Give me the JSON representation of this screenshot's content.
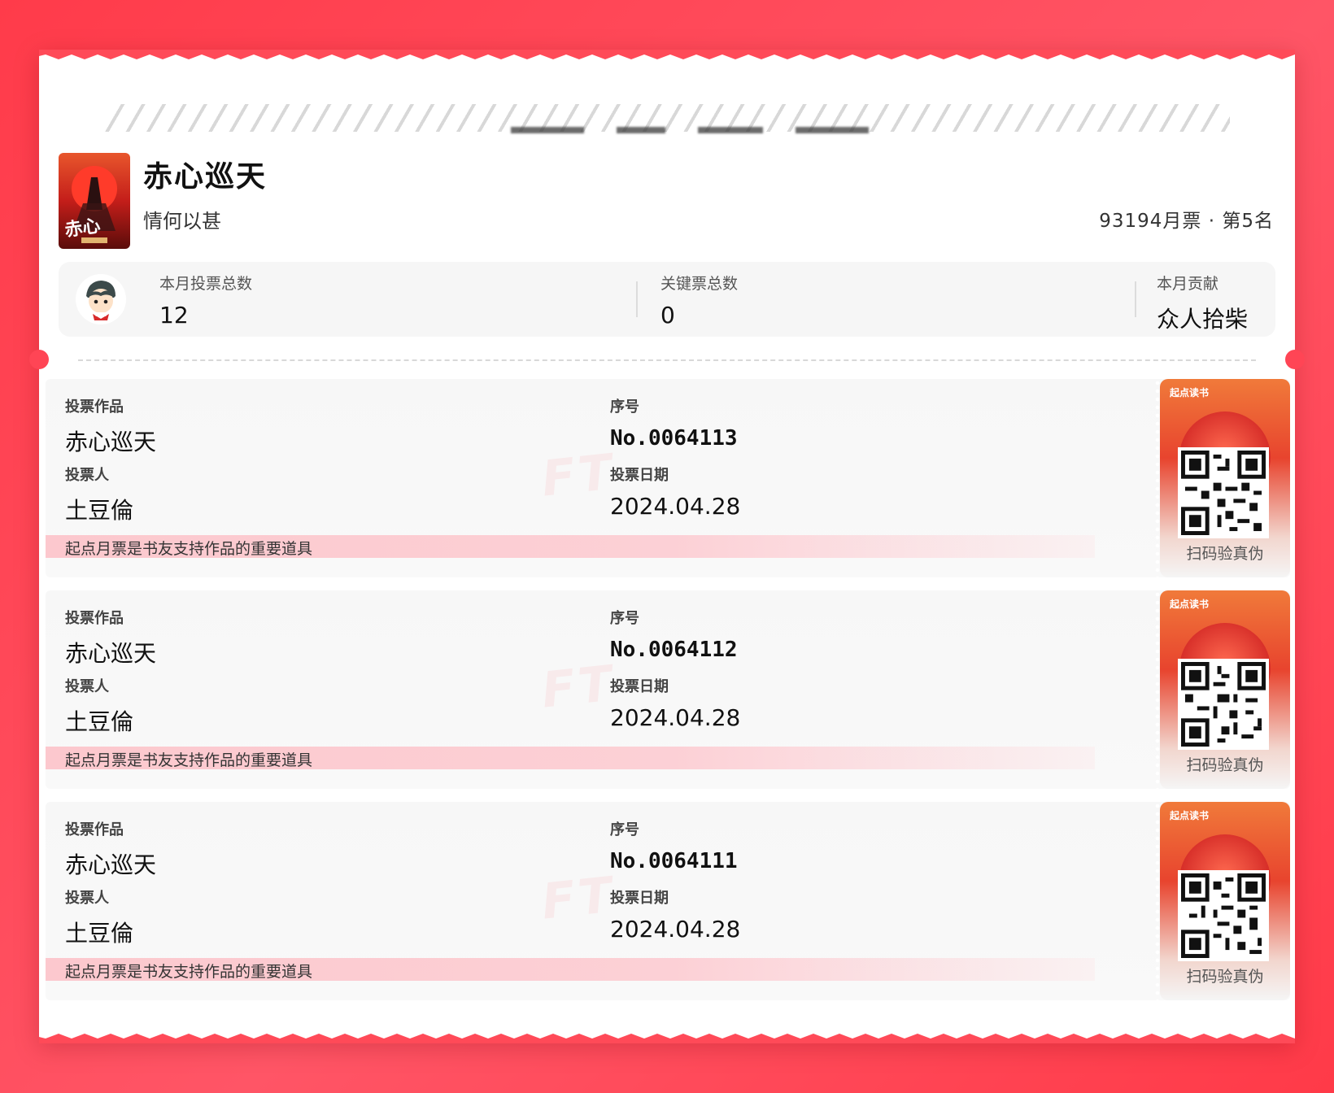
{
  "book": {
    "title": "赤心巡天",
    "author": "情何以甚",
    "rank_text": "93194月票 · 第5名"
  },
  "stats": [
    {
      "label": "本月投票总数",
      "value": "12"
    },
    {
      "label": "关键票总数",
      "value": "0"
    },
    {
      "label": "本月贡献",
      "value": "众人拾柴"
    }
  ],
  "labels": {
    "work": "投票作品",
    "serial": "序号",
    "voter": "投票人",
    "date": "投票日期",
    "slogan": "起点月票是书友支持作品的重要道具",
    "verify": "扫码验真伪",
    "brand": "起点读书"
  },
  "votes": [
    {
      "work": "赤心巡天",
      "serial": "No.0064113",
      "voter": "土豆倫",
      "date": "2024.04.28"
    },
    {
      "work": "赤心巡天",
      "serial": "No.0064112",
      "voter": "土豆倫",
      "date": "2024.04.28"
    },
    {
      "work": "赤心巡天",
      "serial": "No.0064111",
      "voter": "土豆倫",
      "date": "2024.04.28"
    }
  ],
  "colors": {
    "background": "#ff4555",
    "slogan_band": "#ffb3bb",
    "card": "#f7f7f7"
  }
}
